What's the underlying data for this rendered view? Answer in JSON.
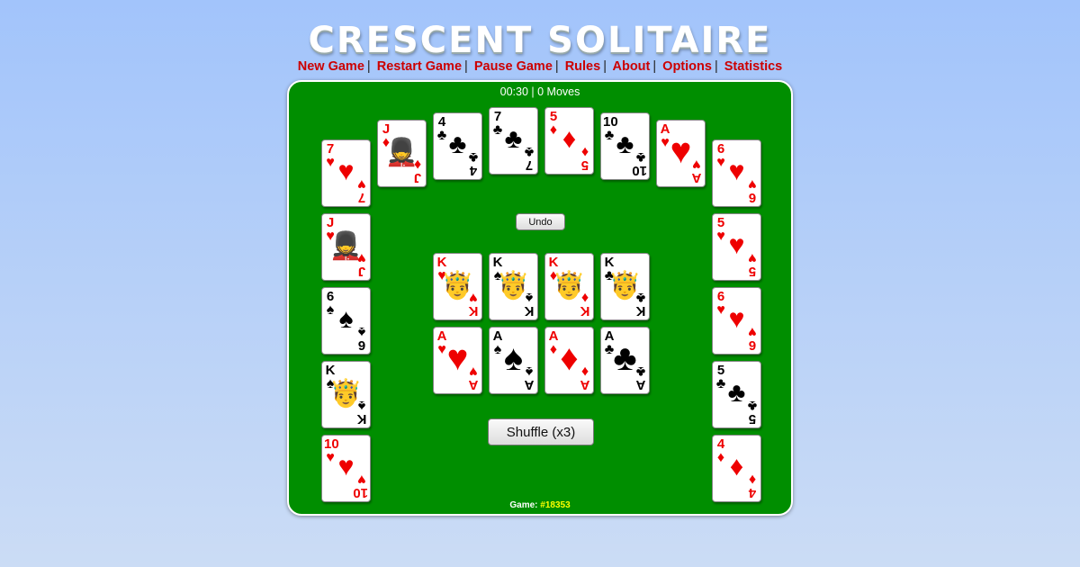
{
  "title": "CRESCENT SOLITAIRE",
  "menu": [
    "New Game",
    "Restart Game",
    "Pause Game",
    "Rules",
    "About",
    "Options",
    "Statistics"
  ],
  "status": {
    "time": "00:30",
    "moves": "0 Moves"
  },
  "undo_label": "Undo",
  "shuffle_label": "Shuffle (x3)",
  "footer": {
    "label": "Game:",
    "number": "#18353"
  },
  "colors": {
    "board": "#008e00",
    "menu_link": "#cc0000",
    "game_number": "#ffff00"
  },
  "crescent": [
    {
      "rank": "10",
      "suit": "♥"
    },
    {
      "rank": "K",
      "suit": "♠"
    },
    {
      "rank": "6",
      "suit": "♠"
    },
    {
      "rank": "J",
      "suit": "♥"
    },
    {
      "rank": "7",
      "suit": "♥"
    },
    {
      "rank": "J",
      "suit": "♦"
    },
    {
      "rank": "4",
      "suit": "♣"
    },
    {
      "rank": "7",
      "suit": "♣"
    },
    {
      "rank": "5",
      "suit": "♦"
    },
    {
      "rank": "10",
      "suit": "♣"
    },
    {
      "rank": "A",
      "suit": "♥"
    },
    {
      "rank": "6",
      "suit": "♥"
    },
    {
      "rank": "5",
      "suit": "♥"
    },
    {
      "rank": "6",
      "suit": "♥"
    },
    {
      "rank": "5",
      "suit": "♣"
    },
    {
      "rank": "4",
      "suit": "♦"
    }
  ],
  "foundations_kings": [
    {
      "rank": "K",
      "suit": "♥"
    },
    {
      "rank": "K",
      "suit": "♠"
    },
    {
      "rank": "K",
      "suit": "♦"
    },
    {
      "rank": "K",
      "suit": "♣"
    }
  ],
  "foundations_aces": [
    {
      "rank": "A",
      "suit": "♥"
    },
    {
      "rank": "A",
      "suit": "♠"
    },
    {
      "rank": "A",
      "suit": "♦"
    },
    {
      "rank": "A",
      "suit": "♣"
    }
  ]
}
